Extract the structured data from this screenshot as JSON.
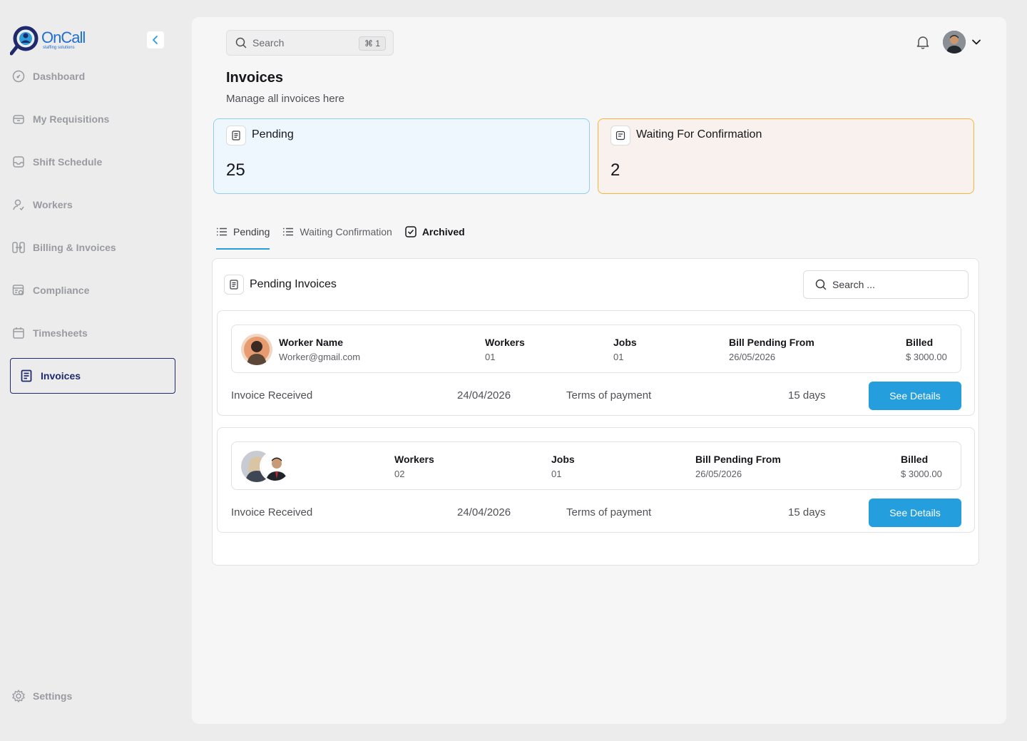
{
  "brand": {
    "name": "OnCall",
    "tagline": "staffing solutions"
  },
  "sidebar": {
    "items": [
      {
        "label": "Dashboard",
        "icon": "dashboard-icon"
      },
      {
        "label": "My Requisitions",
        "icon": "box-icon"
      },
      {
        "label": "Shift Schedule",
        "icon": "inbox-icon"
      },
      {
        "label": "Workers",
        "icon": "user-check-icon"
      },
      {
        "label": "Billing & Invoices",
        "icon": "billing-icon"
      },
      {
        "label": "Compliance",
        "icon": "compliance-icon"
      },
      {
        "label": "Timesheets",
        "icon": "calendar-icon"
      },
      {
        "label": "Invoices",
        "icon": "invoice-icon",
        "active": true
      }
    ],
    "settings": "Settings"
  },
  "header": {
    "search_placeholder": "Search",
    "shortcut": "⌘ 1"
  },
  "page": {
    "title": "Invoices",
    "subtitle": "Manage all invoices here"
  },
  "stats": {
    "pending": {
      "title": "Pending",
      "value": "25"
    },
    "waiting": {
      "title": "Waiting For Confirmation",
      "value": "2"
    }
  },
  "tabs": [
    {
      "label": "Pending",
      "active": true
    },
    {
      "label": "Waiting Confirmation"
    },
    {
      "label": "Archived"
    }
  ],
  "panel": {
    "title": "Pending Invoices",
    "search_placeholder": "Search ...",
    "cards": [
      {
        "worker_name": "Worker Name",
        "worker_email": "Worker@gmail.com",
        "workers_label": "Workers",
        "workers": "01",
        "jobs_label": "Jobs",
        "jobs": "01",
        "bill_label": "Bill Pending From",
        "bill_from": "26/05/2026",
        "billed_label": "Billed",
        "billed": "$ 3000.00",
        "received_label": "Invoice Received",
        "received": "24/04/2026",
        "terms_label": "Terms of payment",
        "terms": "15 days",
        "button": "See Details"
      },
      {
        "workers_label": "Workers",
        "workers": "02",
        "jobs_label": "Jobs",
        "jobs": "01",
        "bill_label": "Bill Pending From",
        "bill_from": "26/05/2026",
        "billed_label": "Billed",
        "billed": "$ 3000.00",
        "received_label": "Invoice Received",
        "received": "24/04/2026",
        "terms_label": "Terms of payment",
        "terms": "15 days",
        "button": "See Details"
      }
    ]
  },
  "colors": {
    "accent": "#259ede",
    "active_nav": "#1e2a6b",
    "pending_border": "#8fd0ee",
    "waiting_border": "#f5b73b"
  }
}
